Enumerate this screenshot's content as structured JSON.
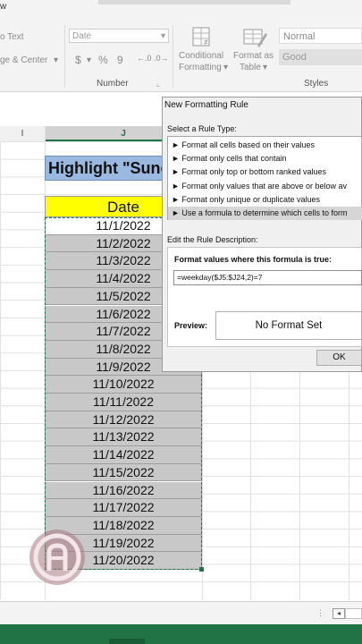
{
  "ribbon": {
    "wrap_text": "o Text",
    "merge_center": "ge & Center",
    "number_format": "Date",
    "currency_symbol": "$",
    "percent_symbol": "%",
    "comma_symbol": "9",
    "number_group_label": "Number",
    "conditional_formatting": [
      "Conditional",
      "Formatting"
    ],
    "format_as_table": [
      "Format as",
      "Table"
    ],
    "style_normal": "Normal",
    "style_good": "Good",
    "styles_group_label": "Styles",
    "corner_letter": "w"
  },
  "columns": {
    "i": "I",
    "j": "J"
  },
  "sheet": {
    "title": "Highlight \"Sunc",
    "date_header": "Date",
    "dates": [
      "11/1/2022",
      "11/2/2022",
      "11/3/2022",
      "11/4/2022",
      "11/5/2022",
      "11/6/2022",
      "11/7/2022",
      "11/8/2022",
      "11/9/2022",
      "11/10/2022",
      "11/11/2022",
      "11/12/2022",
      "11/13/2022",
      "11/14/2022",
      "11/15/2022",
      "11/16/2022",
      "11/17/2022",
      "11/18/2022",
      "11/19/2022",
      "11/20/2022"
    ]
  },
  "dialog": {
    "title": "New Formatting Rule",
    "select_rule_type_label": "Select a Rule Type:",
    "rule_types": [
      "► Format all cells based on their values",
      "► Format only cells that contain",
      "► Format only top or bottom ranked values",
      "► Format only values that are above or below av",
      "► Format only unique or duplicate values",
      "► Use a formula to determine which cells to form"
    ],
    "edit_description_label": "Edit the Rule Description:",
    "formula_label": "Format values where this formula is true:",
    "formula_value": "=weekday($J5:$J24,2)=7",
    "preview_label": "Preview:",
    "preview_text": "No Format Set",
    "ok_label": "OK"
  }
}
